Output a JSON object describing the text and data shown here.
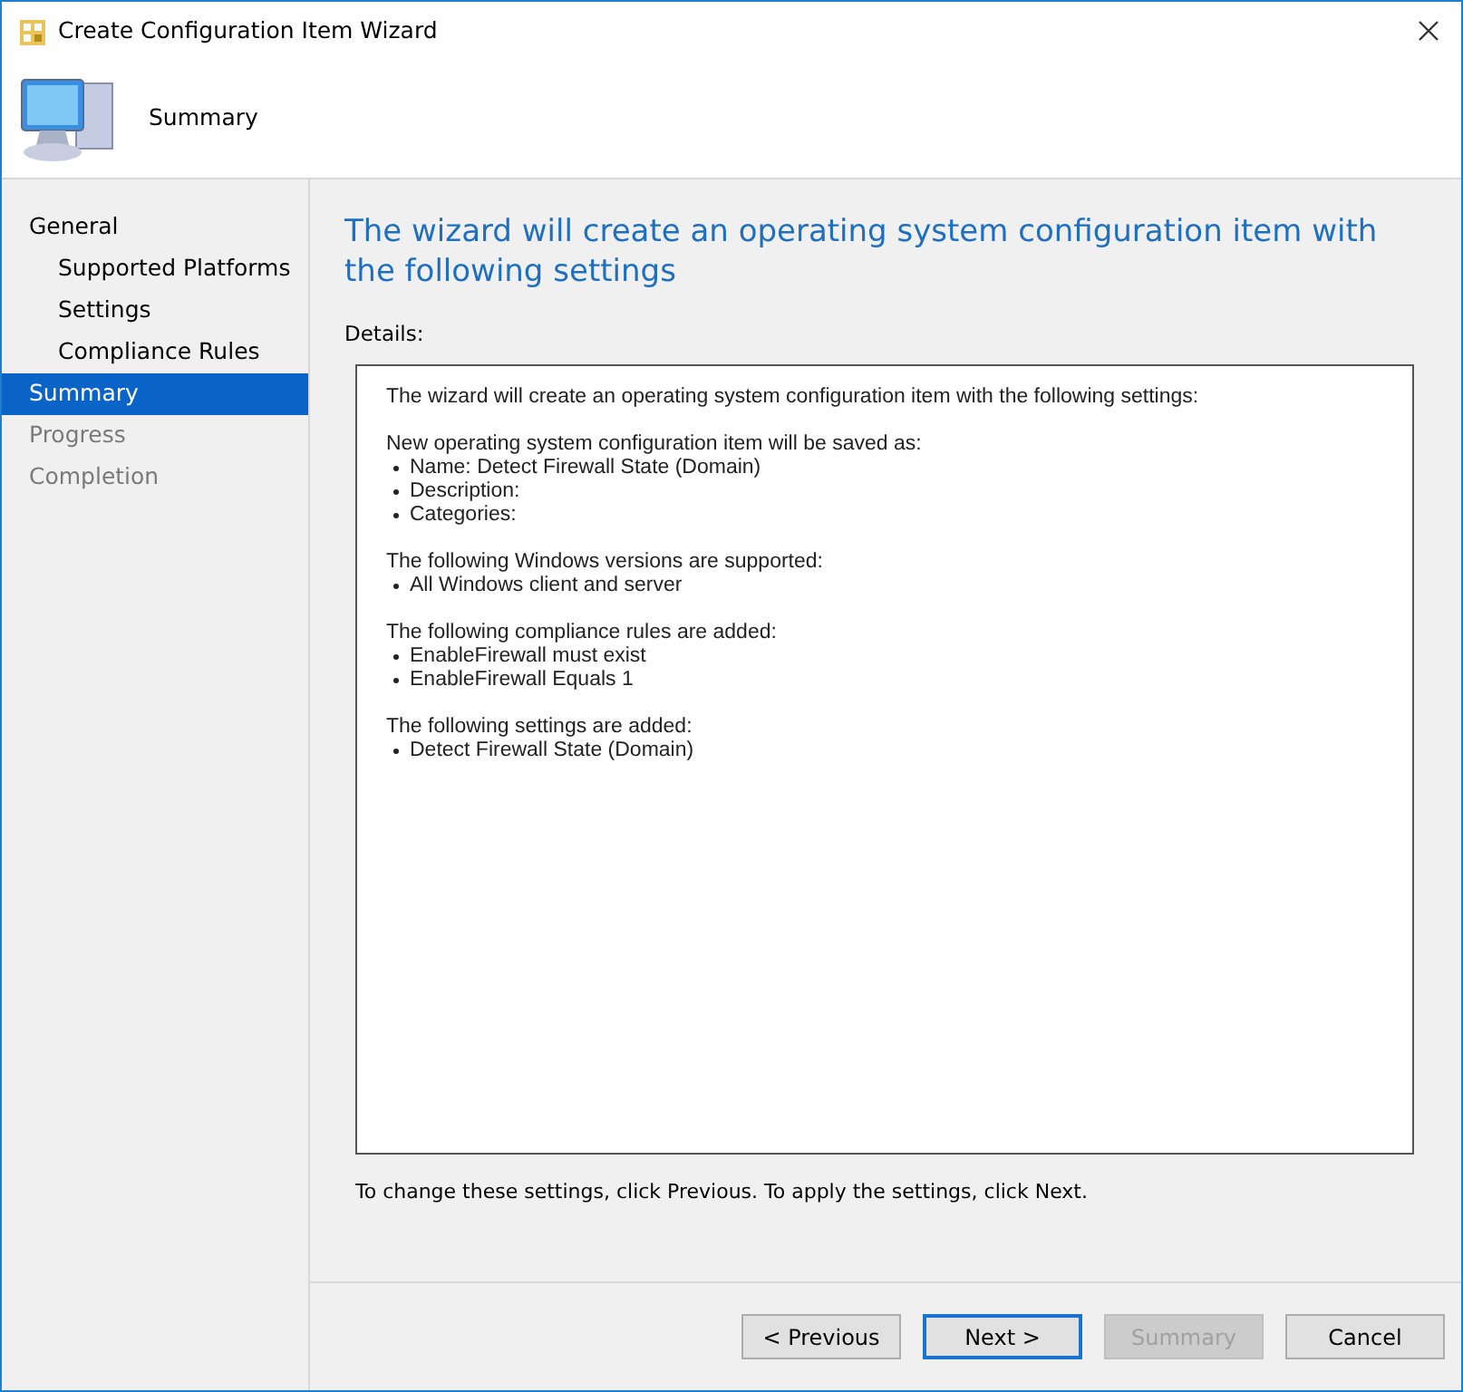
{
  "window": {
    "title": "Create Configuration Item Wizard"
  },
  "header": {
    "title": "Summary"
  },
  "sidebar": {
    "items": [
      {
        "label": "General",
        "selected": false,
        "disabled": false,
        "children": [
          {
            "label": "Supported Platforms",
            "selected": false,
            "disabled": false
          },
          {
            "label": "Settings",
            "selected": false,
            "disabled": false
          },
          {
            "label": "Compliance Rules",
            "selected": false,
            "disabled": false
          }
        ]
      },
      {
        "label": "Summary",
        "selected": true,
        "disabled": false
      },
      {
        "label": "Progress",
        "selected": false,
        "disabled": true
      },
      {
        "label": "Completion",
        "selected": false,
        "disabled": true
      }
    ]
  },
  "content": {
    "heading": "The wizard will create an operating system configuration item with the following settings",
    "details_label": "Details:",
    "details": {
      "intro": "The wizard will create an operating system configuration item with the following settings:",
      "sections": [
        {
          "heading": "New operating system configuration item will be saved as:",
          "bullets": [
            "Name: Detect Firewall State (Domain)",
            "Description:",
            "Categories:"
          ]
        },
        {
          "heading": "The following Windows versions are supported:",
          "bullets": [
            "All Windows client and server"
          ]
        },
        {
          "heading": "The following compliance rules are added:",
          "bullets": [
            "EnableFirewall must exist",
            "EnableFirewall Equals 1"
          ]
        },
        {
          "heading": "The following settings are added:",
          "bullets": [
            "Detect Firewall State (Domain)"
          ]
        }
      ]
    },
    "footnote": "To change these settings, click Previous. To apply the settings, click Next."
  },
  "buttons": [
    {
      "label": "< Previous",
      "default": false,
      "disabled": false
    },
    {
      "label": "Next >",
      "default": true,
      "disabled": false
    },
    {
      "label": "Summary",
      "default": false,
      "disabled": true
    },
    {
      "label": "Cancel",
      "default": false,
      "disabled": false
    }
  ]
}
